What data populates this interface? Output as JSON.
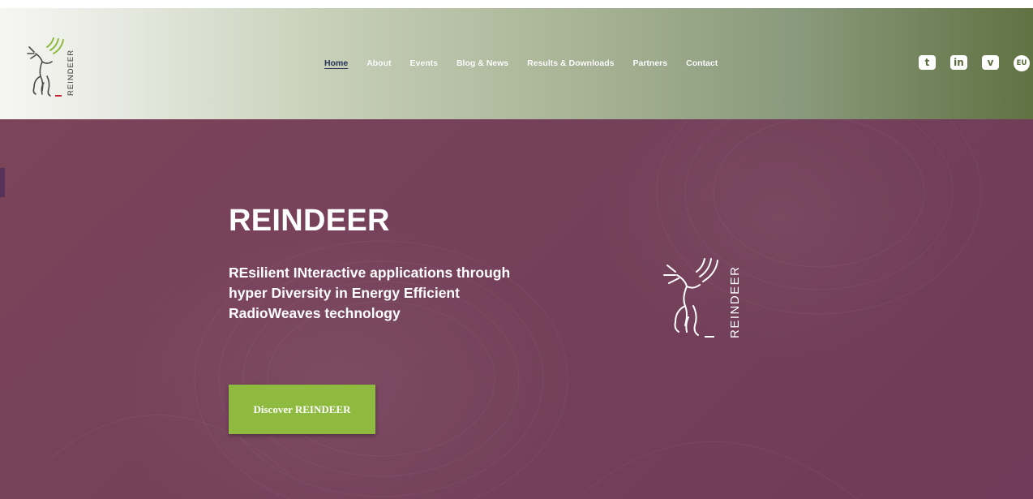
{
  "brand": {
    "logo_text": "REINDEER",
    "colors": {
      "header_start": "#f6f6f4",
      "header_end": "#617243",
      "hero_bg": "#75405a",
      "cta_bg": "#8dba3f",
      "logo_accent": "#8dba3f",
      "logo_red": "#c8202f"
    }
  },
  "nav": {
    "items": [
      {
        "label": "Home",
        "active": true
      },
      {
        "label": "About"
      },
      {
        "label": "Events"
      },
      {
        "label": "Blog & News"
      },
      {
        "label": "Results & Downloads"
      },
      {
        "label": "Partners"
      },
      {
        "label": "Contact"
      }
    ]
  },
  "social": [
    {
      "icon": "twitter-icon",
      "glyph": "t"
    },
    {
      "icon": "linkedin-icon",
      "glyph": "in"
    },
    {
      "icon": "vimeo-icon",
      "glyph": "v"
    },
    {
      "icon": "eu-icon",
      "glyph": "EU"
    }
  ],
  "hero": {
    "title": "REINDEER",
    "subtitle": "REsilient INteractive applications through hyper Diversity in Energy Efficient RadioWeaves technology",
    "logo_text": "REINDEER",
    "cta_label": "Discover REINDEER"
  }
}
